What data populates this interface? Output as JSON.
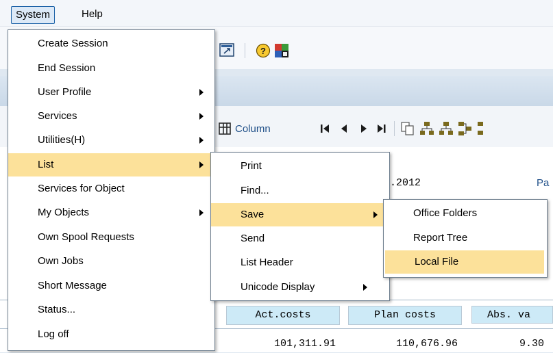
{
  "menubar": {
    "system": "System",
    "help": "Help"
  },
  "system_menu": {
    "items": [
      {
        "label": "Create Session",
        "submenu": false
      },
      {
        "label": "End Session",
        "submenu": false
      },
      {
        "label": "User Profile",
        "submenu": true
      },
      {
        "label": "Services",
        "submenu": true
      },
      {
        "label": "Utilities(H)",
        "submenu": true
      },
      {
        "label": "List",
        "submenu": true,
        "highlighted": true
      },
      {
        "label": "Services for Object",
        "submenu": false
      },
      {
        "label": "My Objects",
        "submenu": true
      },
      {
        "label": "Own Spool Requests",
        "submenu": false
      },
      {
        "label": "Own Jobs",
        "submenu": false
      },
      {
        "label": "Short Message",
        "submenu": false
      },
      {
        "label": "Status...",
        "submenu": false
      },
      {
        "label": "Log off",
        "submenu": false
      }
    ]
  },
  "list_menu": {
    "items": [
      {
        "label": "Print",
        "submenu": false
      },
      {
        "label": "Find...",
        "submenu": false
      },
      {
        "label": "Save",
        "submenu": true,
        "highlighted": true
      },
      {
        "label": "Send",
        "submenu": false
      },
      {
        "label": "List Header",
        "submenu": false
      },
      {
        "label": "Unicode Display",
        "submenu": true
      }
    ]
  },
  "save_menu": {
    "items": [
      {
        "label": "Office Folders",
        "highlighted": false
      },
      {
        "label": "Report Tree",
        "highlighted": false
      },
      {
        "label": "Local File",
        "highlighted": true
      }
    ]
  },
  "toolbar2": {
    "column_label": "Column"
  },
  "content": {
    "date_fragment": ".2012",
    "pa_fragment": "Pa",
    "columns": [
      "Act.costs",
      "Plan costs",
      "Abs. va"
    ],
    "row1": [
      "101,311.91",
      "110,676.96",
      "9.30"
    ]
  },
  "colors": {
    "highlight": "#fce19a",
    "column_header_bg": "#cdeaf7",
    "title_bar": "#c9d8e8"
  }
}
